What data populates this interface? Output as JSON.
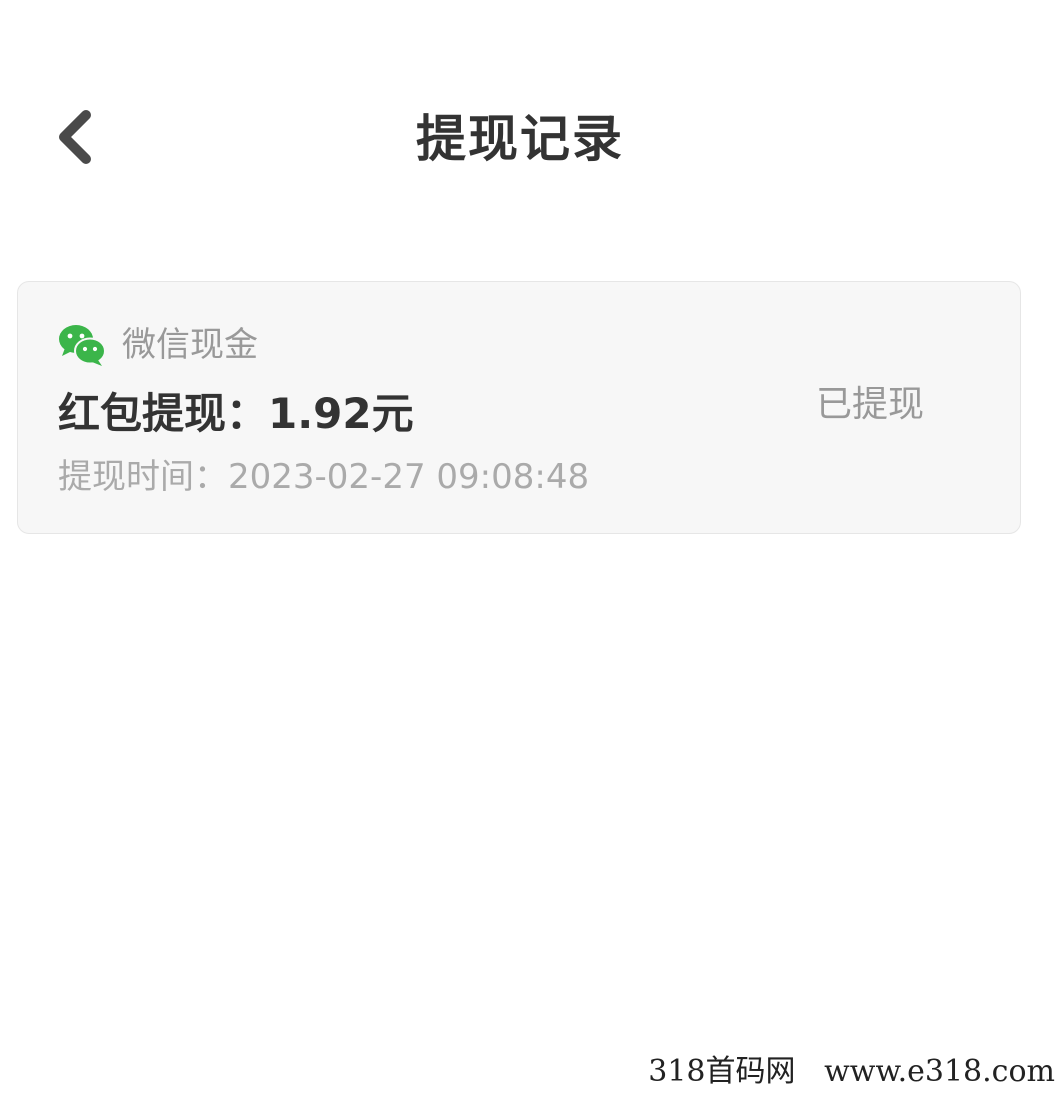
{
  "header": {
    "title": "提现记录",
    "back_icon": "chevron-left-icon"
  },
  "records": [
    {
      "channel_icon": "wechat-icon",
      "channel_label": "微信现金",
      "amount_text": "红包提现：1.92元",
      "status": "已提现",
      "time_text": "提现时间：2023-02-27  09:08:48"
    }
  ],
  "watermark": {
    "text": "318首码网   www.e318.com"
  },
  "colors": {
    "wechat_green": "#3bb54a",
    "title_text": "#333333",
    "secondary_text": "#999999",
    "card_background": "#f7f7f7"
  }
}
